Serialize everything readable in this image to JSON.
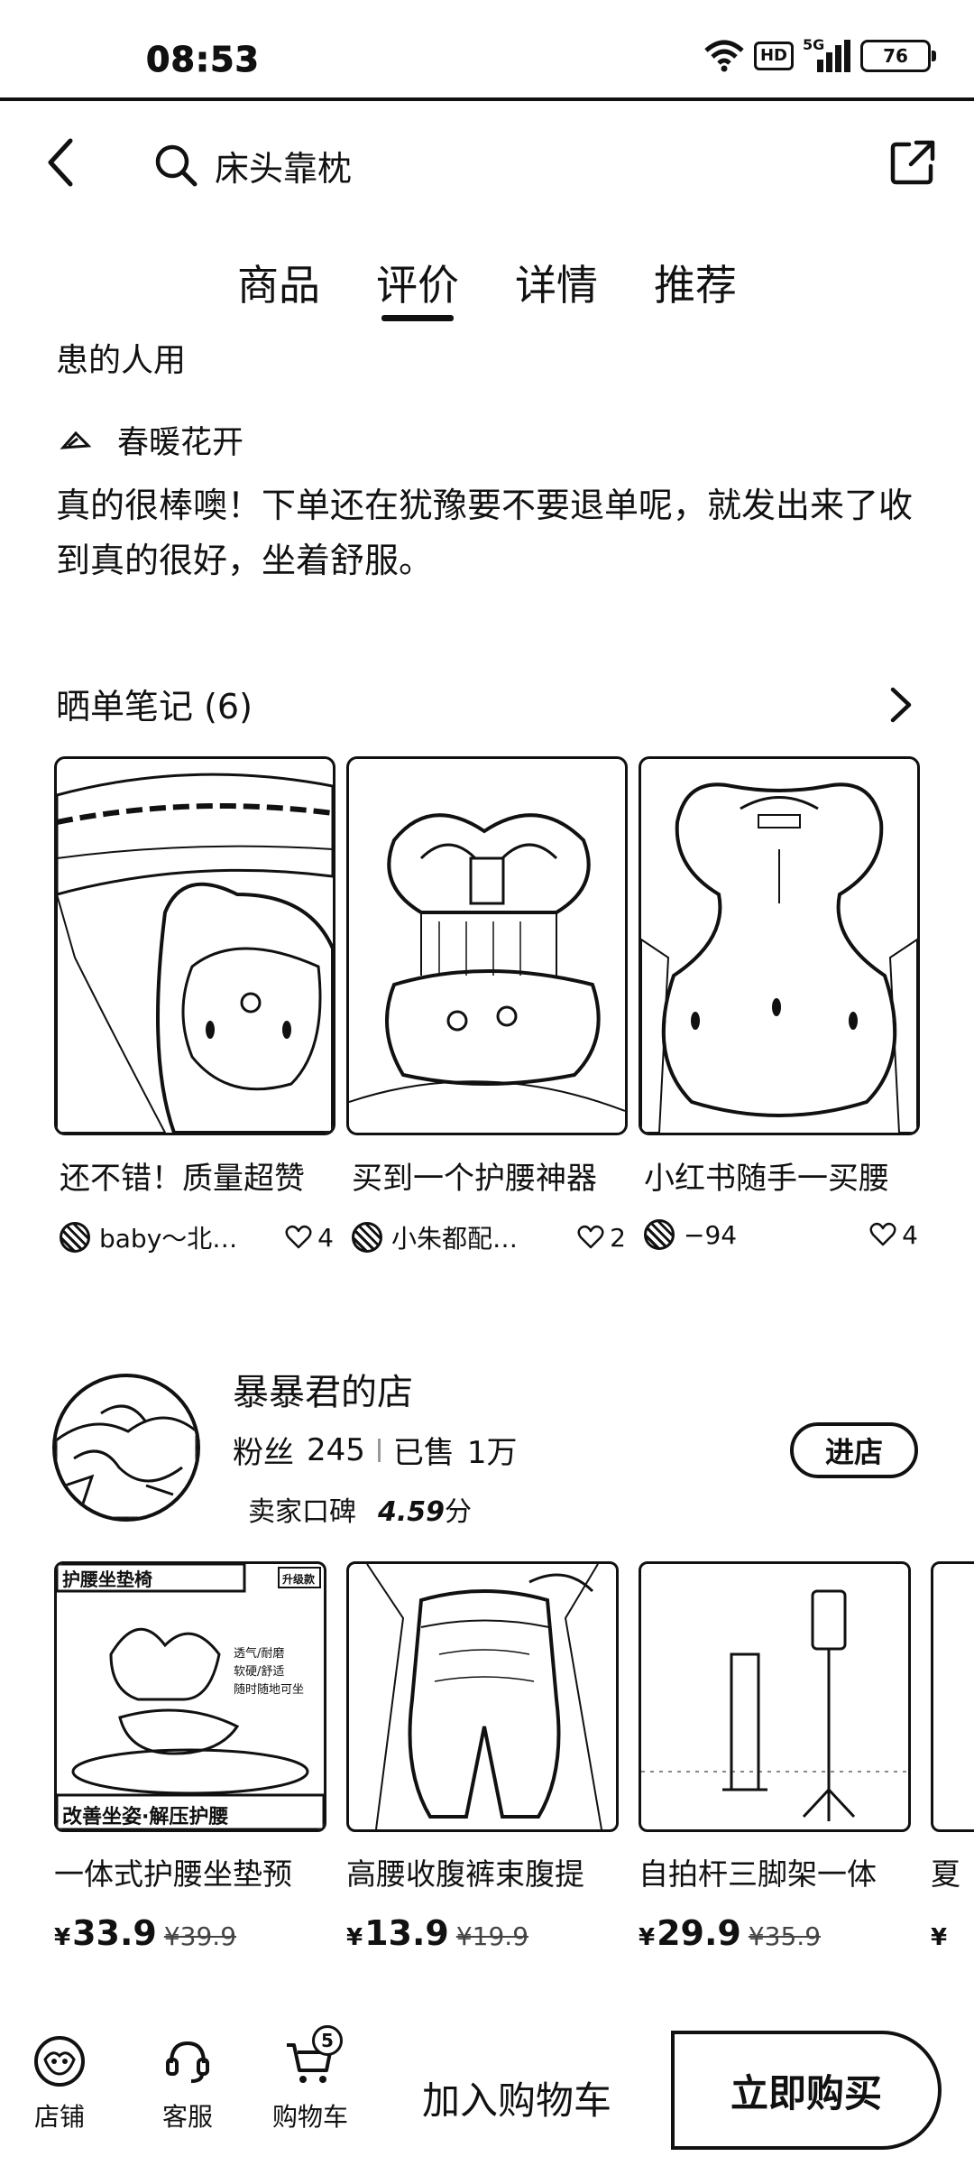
{
  "status_bar": {
    "time": "08:53",
    "network_hd": "HD",
    "network_type": "5G",
    "battery": "76"
  },
  "header": {
    "search_text": "床头靠枕",
    "icons": [
      "back-arrow-icon",
      "search-icon",
      "share-icon"
    ]
  },
  "tabs": [
    {
      "label": "商品",
      "active": false
    },
    {
      "label": "评价",
      "active": true
    },
    {
      "label": "详情",
      "active": false
    },
    {
      "label": "推荐",
      "active": false
    }
  ],
  "review": {
    "truncated_line": "患的人用",
    "reviewer_name": "春暖花开",
    "text": "真的很棒噢！下单还在犹豫要不要退单呢，就发出来了收到真的很好，坐着舒服。"
  },
  "notes": {
    "title": "晒单笔记 (6)",
    "items": [
      {
        "title": "还不错！质量超赞",
        "author": "baby～北…",
        "likes": "4"
      },
      {
        "title": "买到一个护腰神器",
        "author": "小朱都配…",
        "likes": "2"
      },
      {
        "title": "小红书随手一买腰",
        "author": "−94",
        "likes": "4"
      }
    ]
  },
  "shop": {
    "name": "暴暴君的店",
    "fans_label": "粉丝",
    "fans": "245",
    "sold_label": "已售",
    "sold": "1万",
    "rating_label": "卖家口碑",
    "rating": "4.59",
    "rating_unit": "分",
    "enter_label": "进店"
  },
  "products": [
    {
      "title": "一体式护腰坐垫预",
      "currency": "¥",
      "price": "33.9",
      "old_price": "¥39.9",
      "badge_top": "护腰坐垫椅",
      "badge_corner": "升级款",
      "badge_bottom": "改善坐姿·解压护腰",
      "features": [
        "透气/耐磨",
        "软硬/舒适",
        "随时随地可坐"
      ]
    },
    {
      "title": "高腰收腹裤束腹提",
      "currency": "¥",
      "price": "13.9",
      "old_price": "¥19.9"
    },
    {
      "title": "自拍杆三脚架一体",
      "currency": "¥",
      "price": "29.9",
      "old_price": "¥35.9"
    },
    {
      "title": "夏",
      "currency": "¥",
      "price": "",
      "old_price": ""
    }
  ],
  "bottom_bar": {
    "shop_label": "店铺",
    "service_label": "客服",
    "cart_label": "购物车",
    "cart_count": "5",
    "add_to_cart": "加入购物车",
    "buy_now": "立即购买"
  },
  "colors": {
    "ink": "#111111",
    "background": "#ffffff",
    "muted": "#444444"
  }
}
